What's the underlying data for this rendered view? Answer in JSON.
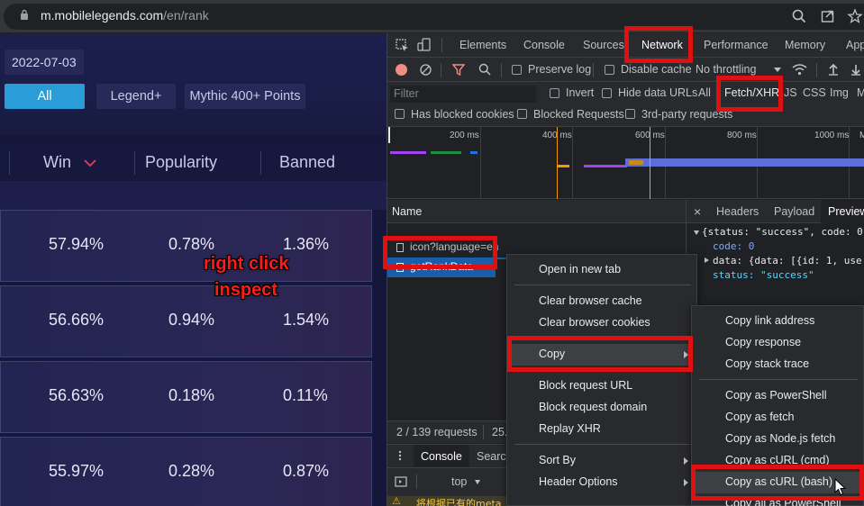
{
  "browser": {
    "url_host": "m.mobilelegends.com",
    "url_path": "/en/rank"
  },
  "site": {
    "date": "2022-07-03",
    "filters": [
      "All",
      "Legend+",
      "Mythic 400+ Points"
    ],
    "columns": [
      "Win",
      "Popularity",
      "Banned"
    ],
    "rows": [
      {
        "win": "57.94%",
        "popularity": "0.78%",
        "banned": "1.36%"
      },
      {
        "win": "56.66%",
        "popularity": "0.94%",
        "banned": "1.54%"
      },
      {
        "win": "56.63%",
        "popularity": "0.18%",
        "banned": "0.11%"
      },
      {
        "win": "55.97%",
        "popularity": "0.28%",
        "banned": "0.87%"
      }
    ],
    "annotation_line1": "right click",
    "annotation_line2": "inspect"
  },
  "devtools": {
    "tabs": [
      "Elements",
      "Console",
      "Sources",
      "Network",
      "Performance",
      "Memory",
      "App"
    ],
    "active_tab": "Network",
    "toolbar": {
      "preserve_log": "Preserve log",
      "disable_cache": "Disable cache",
      "throttling": "No throttling"
    },
    "filterbar": {
      "filter_placeholder": "Filter",
      "invert": "Invert",
      "hide_data_urls": "Hide data URLs",
      "types": [
        "All",
        "Fetch/XHR",
        "JS",
        "CSS",
        "Img",
        "M"
      ],
      "has_blocked_cookies": "Has blocked cookies",
      "blocked_requests": "Blocked Requests",
      "third_party": "3rd-party requests"
    },
    "timeline_ticks": [
      "200 ms",
      "400 ms",
      "600 ms",
      "800 ms",
      "1000 ms",
      "M"
    ],
    "request_list": {
      "header": "Name",
      "rows": [
        "icon?language=en",
        "getRankData"
      ]
    },
    "status": {
      "requests": "2 / 139 requests",
      "transferred": "25."
    },
    "detail": {
      "tabs": [
        "Headers",
        "Payload",
        "Preview"
      ],
      "close": "×",
      "lines": [
        "{status: \"success\", code: 0",
        "code: 0",
        "data: {data: [{id: 1, use",
        "status: \"success\""
      ]
    },
    "drawer": {
      "tabs": [
        "Console",
        "Search"
      ],
      "context": "top",
      "message": "将根据已有的meta"
    }
  },
  "context_menu": {
    "items": [
      "Open in new tab",
      "Clear browser cache",
      "Clear browser cookies",
      "Copy",
      "Block request URL",
      "Block request domain",
      "Replay XHR",
      "Sort By",
      "Header Options"
    ]
  },
  "copy_submenu": {
    "items": [
      "Copy link address",
      "Copy response",
      "Copy stack trace",
      "Copy as PowerShell",
      "Copy as fetch",
      "Copy as Node.js fetch",
      "Copy as cURL (cmd)",
      "Copy as cURL (bash)",
      "Copy all as PowerShell"
    ]
  },
  "colors": {
    "highlight_red": "#e01010",
    "accent_blue": "#2a9cd8",
    "selected_row": "#1a5da8",
    "annotation_red": "#ff1a1a"
  }
}
